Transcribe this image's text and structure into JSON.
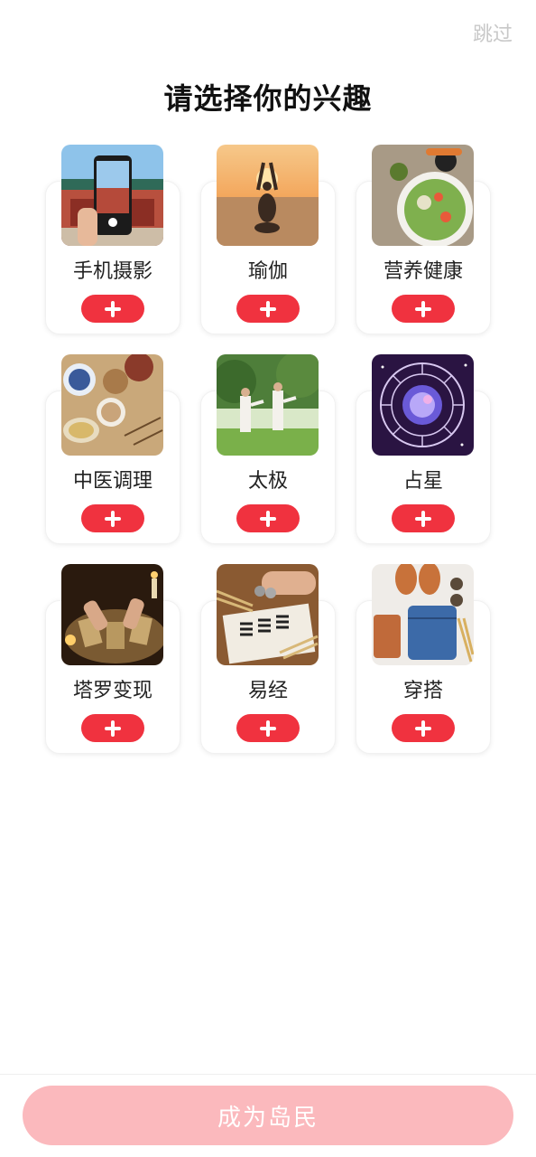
{
  "header": {
    "skip_label": "跳过",
    "title": "请选择你的兴趣"
  },
  "interests": [
    {
      "label": "手机摄影",
      "icon": "phone-photography-image"
    },
    {
      "label": "瑜伽",
      "icon": "yoga-image"
    },
    {
      "label": "营养健康",
      "icon": "salad-image"
    },
    {
      "label": "中医调理",
      "icon": "herbal-tea-image"
    },
    {
      "label": "太极",
      "icon": "tai-chi-image"
    },
    {
      "label": "占星",
      "icon": "zodiac-wheel-image"
    },
    {
      "label": "塔罗变现",
      "icon": "tarot-cards-image"
    },
    {
      "label": "易经",
      "icon": "i-ching-image"
    },
    {
      "label": "穿搭",
      "icon": "outfit-image"
    }
  ],
  "add_icon": "plus-icon",
  "footer": {
    "cta_label": "成为岛民"
  },
  "colors": {
    "accent": "#f0323f",
    "cta_disabled": "#fbb9bd",
    "skip": "#c8c8c8"
  }
}
